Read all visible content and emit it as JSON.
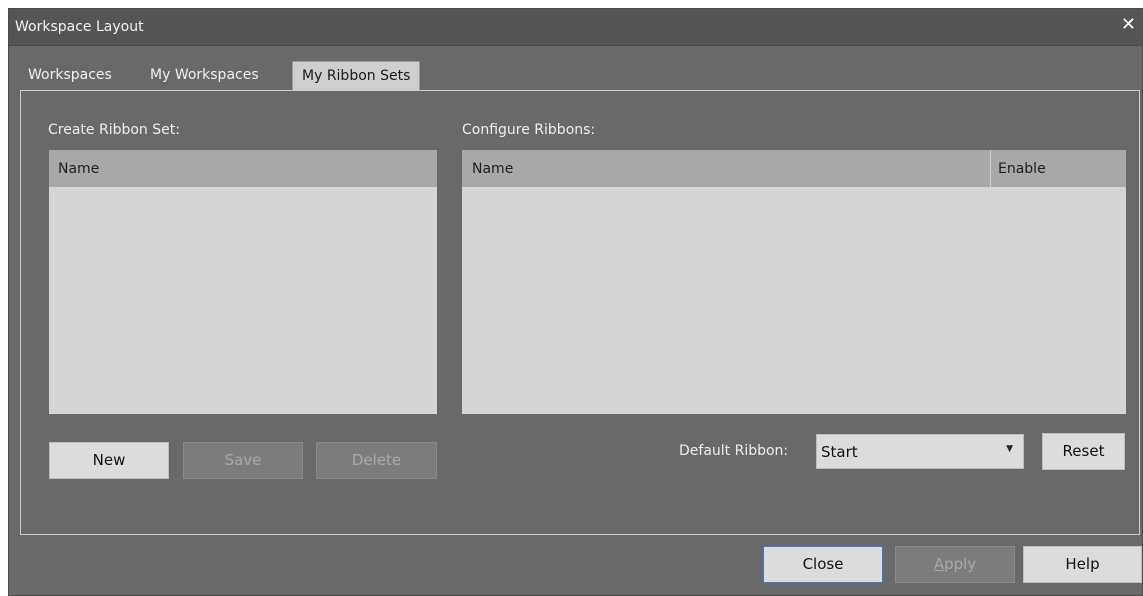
{
  "window": {
    "title": "Workspace Layout",
    "close_glyph": "✕"
  },
  "tabs": [
    {
      "label": "Workspaces",
      "active": false
    },
    {
      "label": "My Workspaces",
      "active": false
    },
    {
      "label": "My Ribbon Sets",
      "active": true
    }
  ],
  "create_set": {
    "label": "Create Ribbon Set:",
    "columns": [
      "Name"
    ],
    "buttons": {
      "new": "New",
      "save": "Save",
      "delete": "Delete"
    }
  },
  "configure": {
    "label": "Configure Ribbons:",
    "columns": [
      "Name",
      "Enable"
    ],
    "default_ribbon_label": "Default Ribbon:",
    "default_ribbon_value": "Start",
    "reset": "Reset"
  },
  "footer": {
    "close": "Close",
    "apply_mnemonic": "A",
    "apply_rest": "pply",
    "help": "Help"
  },
  "colors": {
    "background": "#696969",
    "titlebar": "#555555",
    "list_bg": "#d5d5d5",
    "list_header": "#a8a8a8",
    "focus_border": "#3a7bd5"
  }
}
